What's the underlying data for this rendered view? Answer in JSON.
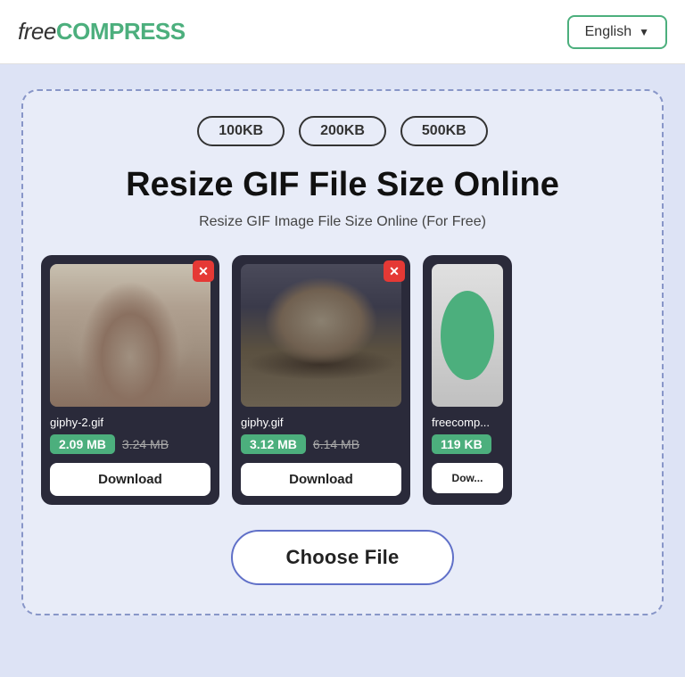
{
  "header": {
    "logo_free": "free",
    "logo_compress": "COMPRESS",
    "lang_label": "English",
    "lang_chevron": "▼"
  },
  "size_badges": [
    "100KB",
    "200KB",
    "500KB"
  ],
  "page_title": "Resize GIF File Size Online",
  "page_subtitle": "Resize GIF Image File Size Online (For Free)",
  "images": [
    {
      "filename": "giphy-2.gif",
      "size_new": "2.09 MB",
      "size_old": "3.24 MB",
      "download_label": "Download",
      "type": "cat1"
    },
    {
      "filename": "giphy.gif",
      "size_new": "3.12 MB",
      "size_old": "6.14 MB",
      "download_label": "Download",
      "type": "cat2"
    },
    {
      "filename": "freecomp...",
      "size_new": "119 KB",
      "size_old": "",
      "download_label": "Dow...",
      "type": "partial"
    }
  ],
  "choose_file_label": "Choose File"
}
